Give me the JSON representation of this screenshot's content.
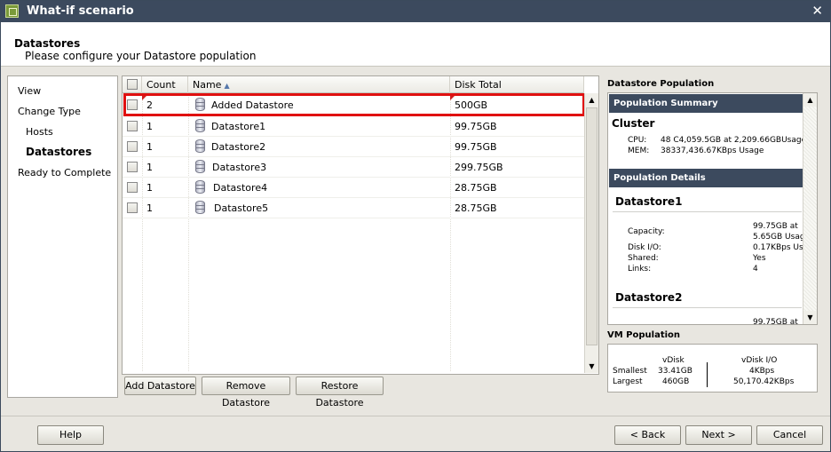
{
  "window": {
    "title": "What-if scenario"
  },
  "header": {
    "title": "Datastores",
    "subtitle": "Please configure your Datastore population"
  },
  "nav": {
    "items": [
      {
        "label": "View"
      },
      {
        "label": "Change Type"
      },
      {
        "label": "Hosts"
      },
      {
        "label": "Datastores"
      },
      {
        "label": "Ready to Complete"
      }
    ]
  },
  "grid": {
    "columns": {
      "count": "Count",
      "name": "Name",
      "disk_total": "Disk Total"
    },
    "rows": [
      {
        "count": "2",
        "name": "Added Datastore",
        "disk": "500GB"
      },
      {
        "count": "1",
        "name": "Datastore1",
        "disk": "99.75GB"
      },
      {
        "count": "1",
        "name": "Datastore2",
        "disk": "99.75GB"
      },
      {
        "count": "1",
        "name": "Datastore3",
        "disk": "299.75GB"
      },
      {
        "count": "1",
        "name": "Datastore4",
        "disk": "28.75GB"
      },
      {
        "count": "1",
        "name": "Datastore5",
        "disk": "28.75GB"
      }
    ],
    "buttons": {
      "add": "Add Datastore",
      "remove": "Remove Datastore",
      "restore": "Restore Datastore"
    }
  },
  "population": {
    "title": "Datastore Population",
    "summary_header": "Population Summary",
    "cluster": "Cluster",
    "cpu_label": "CPU:",
    "cpu_value": "48 C4,059.5GB at  2,209.66GBUsage",
    "mem_label": "MEM:",
    "mem_value": "38337,436.67KBps Usage",
    "details_header": "Population Details",
    "ds1": {
      "name": "Datastore1",
      "capacity_label": "Capacity:",
      "capacity_value1": "99.75GB at",
      "capacity_value2": "5.65GB Usag",
      "diskio_label": "Disk I/O:",
      "diskio_value": "0.17KBps Usa",
      "shared_label": "Shared:",
      "shared_value": "Yes",
      "links_label": "Links:",
      "links_value": "4"
    },
    "ds2": {
      "name": "Datastore2",
      "capacity_value1": "99.75GB at"
    }
  },
  "vm": {
    "title": "VM Population",
    "vdisk_header": "vDisk",
    "vdiskio_header": "vDisk I/O",
    "smallest_label": "Smallest",
    "smallest_vdisk": "33.41GB",
    "smallest_io": "4KBps",
    "largest_label": "Largest",
    "largest_vdisk": "460GB",
    "largest_io": "50,170.42KBps"
  },
  "footer": {
    "help": "Help",
    "back": "< Back",
    "next": "Next >",
    "cancel": "Cancel"
  }
}
